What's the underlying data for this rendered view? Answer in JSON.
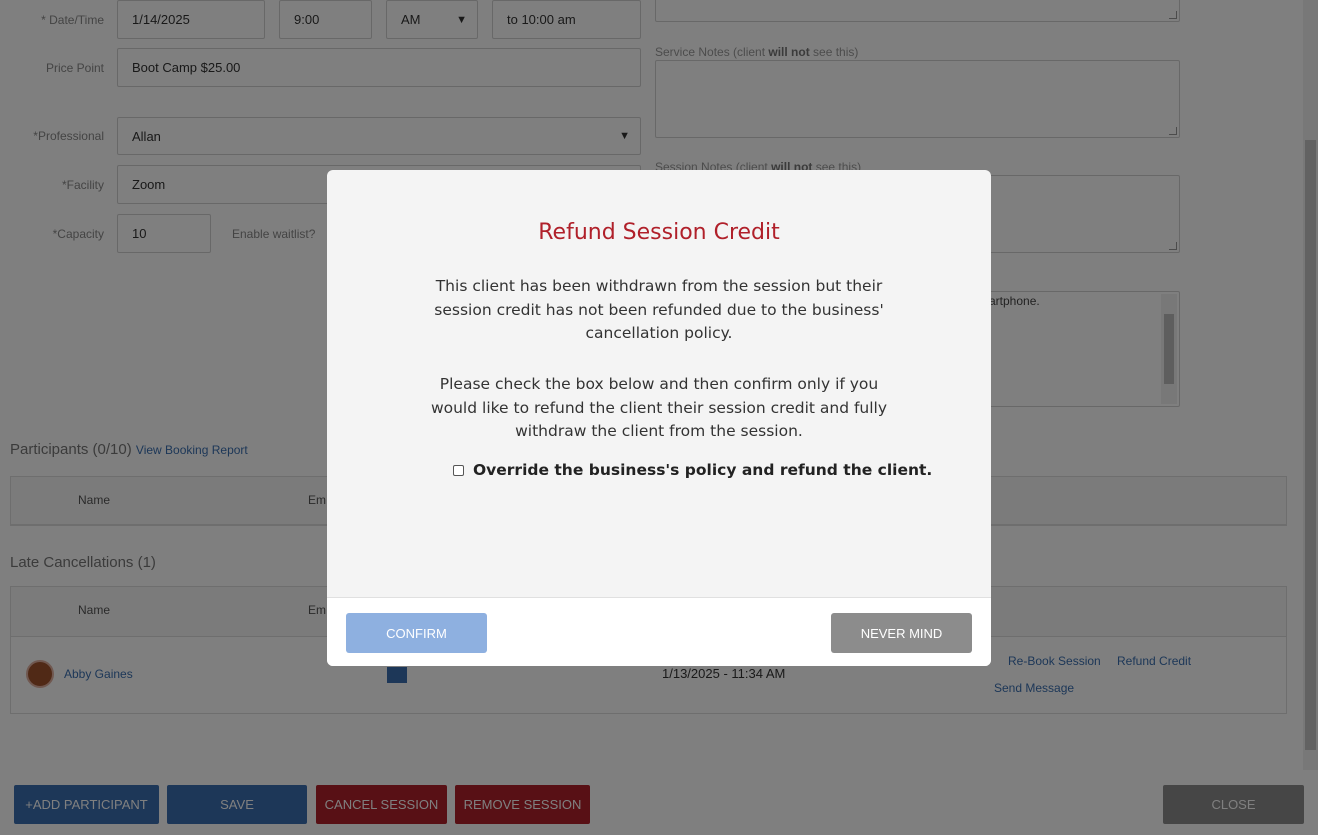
{
  "form": {
    "date_time_label": "* Date/Time",
    "date_value": "1/14/2025",
    "time_value": "9:00",
    "ampm_value": "AM",
    "end_time": "to 10:00 am",
    "price_label": "Price Point",
    "price_value": "Boot Camp $25.00",
    "professional_label": "*Professional",
    "professional_value": "Allan",
    "facility_label": "*Facility",
    "facility_value": "Zoom",
    "capacity_label": "*Capacity",
    "capacity_value": "10",
    "waitlist_label": "Enable waitlist?"
  },
  "notes": {
    "service_notes_prefix": "Service Notes (client ",
    "service_notes_bold": "will not",
    "service_notes_suffix": " see this)",
    "session_notes_prefix": "Session Notes (client ",
    "session_notes_bold": "will not",
    "session_notes_suffix": " see this)",
    "instructions_fragment": "artphone."
  },
  "participants": {
    "title": "Participants (0/10)",
    "report_link": "View Booking Report",
    "col_name": "Name",
    "col_email": "Em"
  },
  "late_cancellations": {
    "title": "Late Cancellations (1)",
    "col_name": "Name",
    "col_email": "Em",
    "row": {
      "name": "Abby Gaines",
      "date": "1/13/2025 - 11:34 AM",
      "rebook": "Re-Book Session",
      "refund": "Refund Credit",
      "message": "Send Message"
    }
  },
  "buttons": {
    "add_participant": "+ADD PARTICIPANT",
    "save": "SAVE",
    "cancel_session": "CANCEL SESSION",
    "remove_session": "REMOVE SESSION",
    "close": "CLOSE"
  },
  "modal": {
    "title": "Refund Session Credit",
    "paragraph1": "This client has been withdrawn from the session but their session credit has not been refunded due to the business' cancellation policy.",
    "paragraph2": "Please check the box below and then confirm only if you would like to refund the client their session credit and fully withdraw the client from the session.",
    "checkbox_label": "Override the business's policy and refund the client.",
    "checkbox_checked": false,
    "confirm_label": "CONFIRM",
    "never_mind_label": "NEVER MIND"
  },
  "colors": {
    "modal_title": "#b0202a",
    "confirm_button": "#8eb0e0",
    "never_mind_button": "#8c8c8c",
    "primary_button": "#3a6fb0",
    "danger_button": "#b0202a"
  }
}
